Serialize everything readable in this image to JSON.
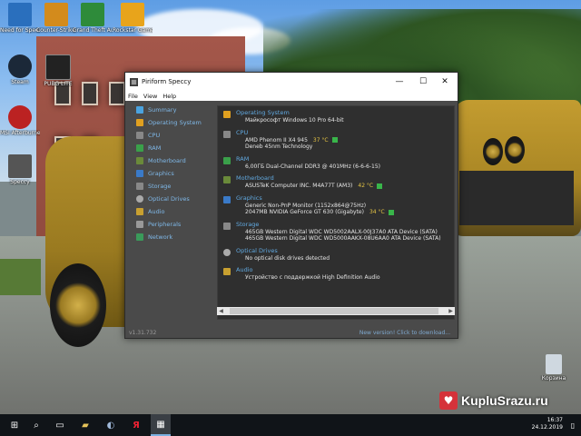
{
  "desktop": {
    "icons": [
      {
        "label": "Need for Speed",
        "name": "need-for-speed-icon",
        "color": "#2a6fbd"
      },
      {
        "label": "Counter-Strike Global Offe...",
        "name": "counter-strike-icon",
        "color": "#d38b1c"
      },
      {
        "label": "Grand Theft Auto V",
        "name": "gta-v-icon",
        "color": "#2e8b3a"
      },
      {
        "label": "Rockstar Games...",
        "name": "rockstar-icon",
        "color": "#e8a41b"
      },
      {
        "label": "Steam",
        "name": "steam-icon",
        "color": "#1b2838"
      },
      {
        "label": "PUBG LITE",
        "name": "pubg-lite-icon",
        "color": "#222"
      },
      {
        "label": "MSI Afterburner",
        "name": "msi-afterburner-icon",
        "color": "#b22"
      },
      {
        "label": "Speccy",
        "name": "speccy-icon",
        "color": "#555"
      },
      {
        "label": "Корзина",
        "name": "recycle-bin-icon",
        "color": "#cfd8e0"
      }
    ]
  },
  "window": {
    "title": "Piriform Speccy",
    "menu": [
      "File",
      "View",
      "Help"
    ],
    "controls": {
      "minimize": "—",
      "maximize": "☐",
      "close": "✕"
    },
    "nav": [
      {
        "label": "Summary",
        "color": "#4aa3df"
      },
      {
        "label": "Operating System",
        "color": "#e0a020"
      },
      {
        "label": "CPU",
        "color": "#888"
      },
      {
        "label": "RAM",
        "color": "#3aa04a"
      },
      {
        "label": "Motherboard",
        "color": "#6a8a3a"
      },
      {
        "label": "Graphics",
        "color": "#3a7ac8"
      },
      {
        "label": "Storage",
        "color": "#888"
      },
      {
        "label": "Optical Drives",
        "color": "#aaa"
      },
      {
        "label": "Audio",
        "color": "#c8a030"
      },
      {
        "label": "Peripherals",
        "color": "#999"
      },
      {
        "label": "Network",
        "color": "#3a9a5a"
      }
    ],
    "sections": [
      {
        "head": "Operating System",
        "color": "#e0a020",
        "lines": [
          "Майкрософт Windows 10 Pro 64-bit"
        ]
      },
      {
        "head": "CPU",
        "color": "#888",
        "lines": [
          "AMD Phenom II X4 945",
          "Deneb 45nm Technology"
        ],
        "temp": "37 °C"
      },
      {
        "head": "RAM",
        "color": "#3aa04a",
        "lines": [
          "6,00ГБ Dual-Channel DDR3 @ 401MHz (6-6-6-15)"
        ]
      },
      {
        "head": "Motherboard",
        "color": "#6a8a3a",
        "lines": [
          "ASUSTeK Computer INC. M4A77T (AM3)"
        ],
        "temp": "42 °C"
      },
      {
        "head": "Graphics",
        "color": "#3a7ac8",
        "lines": [
          "Generic Non-PnP Monitor (1152x864@75Hz)",
          "2047MB NVIDIA GeForce GT 630 (Gigabyte)"
        ],
        "temp": "34 °C"
      },
      {
        "head": "Storage",
        "color": "#888",
        "lines": [
          "465GB Western Digital WDC WD5002AALX-00J37A0 ATA Device (SATA)",
          "465GB Western Digital WDC WD5000AAKX-08U6AA0 ATA Device (SATA)"
        ]
      },
      {
        "head": "Optical Drives",
        "color": "#aaa",
        "lines": [
          "No optical disk drives detected"
        ]
      },
      {
        "head": "Audio",
        "color": "#c8a030",
        "lines": [
          "Устройство с поддержкой High Definition Audio"
        ]
      }
    ],
    "status": {
      "version": "v1.31.732",
      "update": "New version! Click to download..."
    }
  },
  "taskbar": {
    "start": "⊞",
    "search": "⌕",
    "taskview": "▭",
    "explorer": "▰",
    "steam": "◐",
    "yandex": "Я",
    "speccy": "▦",
    "time": "16:37",
    "date": "24.12.2019"
  },
  "watermark": {
    "text": "KupluSrazu.ru",
    "heart": "♥"
  }
}
